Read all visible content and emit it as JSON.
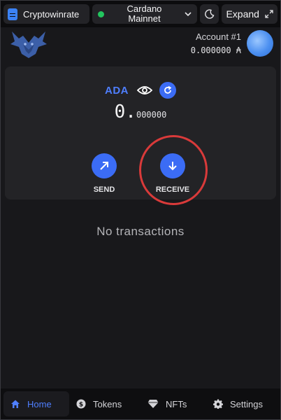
{
  "topbar": {
    "site_name": "Cryptowinrate",
    "network": "Cardano\nMainnet",
    "expand_label": "Expand"
  },
  "header": {
    "account_name": "Account #1",
    "account_balance": "0.000000 ₳"
  },
  "wallet": {
    "asset": "ADA",
    "balance_int": "0.",
    "balance_dec": "000000",
    "send_label": "SEND",
    "receive_label": "RECEIVE"
  },
  "transactions": {
    "empty_message": "No transactions"
  },
  "nav": {
    "home": "Home",
    "tokens": "Tokens",
    "nfts": "NFTs",
    "settings": "Settings"
  },
  "colors": {
    "accent": "#3b6cf5",
    "accent_text": "#4f7fff",
    "status_online": "#22c55e",
    "highlight": "#d93a3a",
    "background": "#18181b"
  },
  "icons": [
    "document-icon",
    "chevron-down-icon",
    "moon-icon",
    "expand-icon",
    "eye-icon",
    "refresh-icon",
    "send-arrow-icon",
    "receive-arrow-icon",
    "home-icon",
    "coin-icon",
    "diamond-icon",
    "gear-icon"
  ]
}
